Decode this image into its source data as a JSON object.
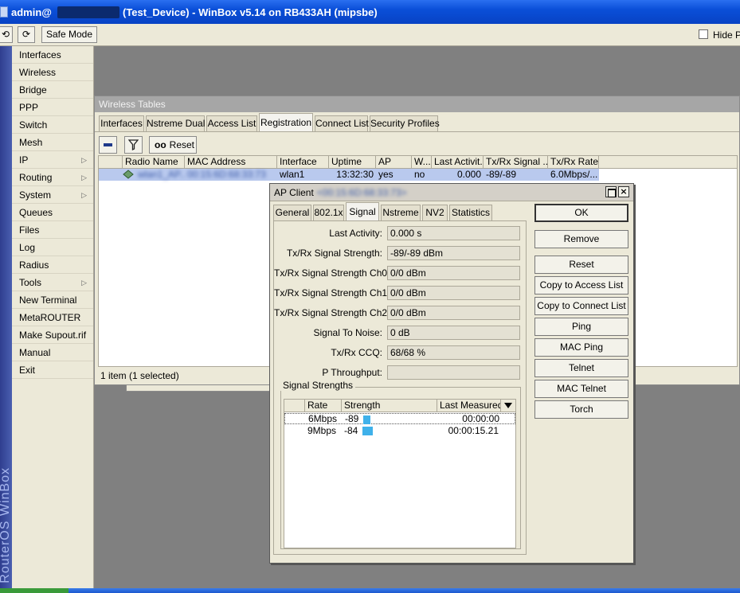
{
  "window": {
    "title_prefix": "admin@",
    "title_suffix": "(Test_Device) - WinBox v5.14 on RB433AH (mipsbe)"
  },
  "toolbar": {
    "undo_label": "⟲",
    "redo_label": "⟳",
    "safe_mode": "Safe Mode",
    "hide_label": "Hide P"
  },
  "brand": "RouterOS WinBox",
  "menu": [
    {
      "label": "Interfaces",
      "has_submenu": false
    },
    {
      "label": "Wireless",
      "has_submenu": false
    },
    {
      "label": "Bridge",
      "has_submenu": false
    },
    {
      "label": "PPP",
      "has_submenu": false
    },
    {
      "label": "Switch",
      "has_submenu": false
    },
    {
      "label": "Mesh",
      "has_submenu": false
    },
    {
      "label": "IP",
      "has_submenu": true
    },
    {
      "label": "Routing",
      "has_submenu": true
    },
    {
      "label": "System",
      "has_submenu": true
    },
    {
      "label": "Queues",
      "has_submenu": false
    },
    {
      "label": "Files",
      "has_submenu": false
    },
    {
      "label": "Log",
      "has_submenu": false
    },
    {
      "label": "Radius",
      "has_submenu": false
    },
    {
      "label": "Tools",
      "has_submenu": true
    },
    {
      "label": "New Terminal",
      "has_submenu": false
    },
    {
      "label": "MetaROUTER",
      "has_submenu": false
    },
    {
      "label": "Make Supout.rif",
      "has_submenu": false
    },
    {
      "label": "Manual",
      "has_submenu": false
    },
    {
      "label": "Exit",
      "has_submenu": false
    }
  ],
  "wireless_tables": {
    "title": "Wireless Tables",
    "tabs": [
      "Interfaces",
      "Nstreme Dual",
      "Access List",
      "Registration",
      "Connect List",
      "Security Profiles"
    ],
    "active_tab": "Registration",
    "reset_label": "Reset",
    "reset_prefix": "oo",
    "columns": [
      "Radio Name",
      "MAC Address",
      "Interface",
      "Uptime",
      "AP",
      "W...",
      "Last Activit...",
      "Tx/Rx Signal ...",
      "Tx/Rx Rate"
    ],
    "rows": [
      {
        "radio_name": "wlan1_AP...",
        "mac": "00:15:6D:68:33:73",
        "interface": "wlan1",
        "uptime": "13:32:30",
        "ap": "yes",
        "w": "no",
        "last_activity": "0.000",
        "signal": "-89/-89",
        "rate": "6.0Mbps/..."
      }
    ],
    "status": "1 item (1 selected)"
  },
  "ap_client": {
    "title": "AP Client",
    "title_mac": "<00:15:6D:68:33:73>",
    "tabs": [
      "General",
      "802.1x",
      "Signal",
      "Nstreme",
      "NV2",
      "Statistics"
    ],
    "active_tab": "Signal",
    "fields": [
      {
        "label": "Last Activity:",
        "value": "0.000 s"
      },
      {
        "label": "Tx/Rx Signal Strength:",
        "value": "-89/-89 dBm"
      },
      {
        "label": "Tx/Rx Signal Strength Ch0:",
        "value": "0/0 dBm"
      },
      {
        "label": "Tx/Rx Signal Strength Ch1:",
        "value": "0/0 dBm"
      },
      {
        "label": "Tx/Rx Signal Strength Ch2:",
        "value": "0/0 dBm"
      },
      {
        "label": "Signal To Noise:",
        "value": "0 dB"
      },
      {
        "label": "Tx/Rx CCQ:",
        "value": "68/68 %"
      },
      {
        "label": "P Throughput:",
        "value": ""
      }
    ],
    "signal_strengths": {
      "group_label": "Signal Strengths",
      "columns": [
        "Rate",
        "Strength",
        "Last Measured"
      ],
      "rows": [
        {
          "rate": "6Mbps",
          "strength": "-89",
          "last_measured": "00:00:00",
          "level": 0.1
        },
        {
          "rate": "9Mbps",
          "strength": "-84",
          "last_measured": "00:00:15.21",
          "level": 0.14
        }
      ]
    },
    "buttons": [
      "OK",
      "Remove",
      "Reset",
      "Copy to Access List",
      "Copy to Connect List",
      "Ping",
      "MAC Ping",
      "Telnet",
      "MAC Telnet",
      "Torch"
    ],
    "close_label": "×"
  }
}
